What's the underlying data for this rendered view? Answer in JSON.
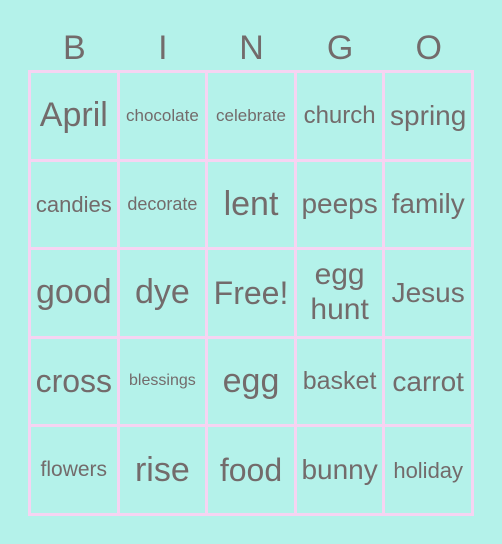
{
  "header": [
    "B",
    "I",
    "N",
    "G",
    "O"
  ],
  "colors": {
    "background": "#b4f2ea",
    "grid": "#f6d4f2",
    "text": "#736b6b"
  },
  "cells": [
    {
      "text": "April",
      "size": 34
    },
    {
      "text": "chocolate",
      "size": 17
    },
    {
      "text": "celebrate",
      "size": 17
    },
    {
      "text": "church",
      "size": 24
    },
    {
      "text": "spring",
      "size": 28
    },
    {
      "text": "candies",
      "size": 22
    },
    {
      "text": "decorate",
      "size": 18
    },
    {
      "text": "lent",
      "size": 34
    },
    {
      "text": "peeps",
      "size": 28
    },
    {
      "text": "family",
      "size": 28
    },
    {
      "text": "good",
      "size": 34
    },
    {
      "text": "dye",
      "size": 34
    },
    {
      "text": "Free!",
      "size": 32
    },
    {
      "text": "egg hunt",
      "size": 30
    },
    {
      "text": "Jesus",
      "size": 28
    },
    {
      "text": "cross",
      "size": 32
    },
    {
      "text": "blessings",
      "size": 16
    },
    {
      "text": "egg",
      "size": 34
    },
    {
      "text": "basket",
      "size": 25
    },
    {
      "text": "carrot",
      "size": 28
    },
    {
      "text": "flowers",
      "size": 21
    },
    {
      "text": "rise",
      "size": 34
    },
    {
      "text": "food",
      "size": 32
    },
    {
      "text": "bunny",
      "size": 28
    },
    {
      "text": "holiday",
      "size": 22
    }
  ]
}
